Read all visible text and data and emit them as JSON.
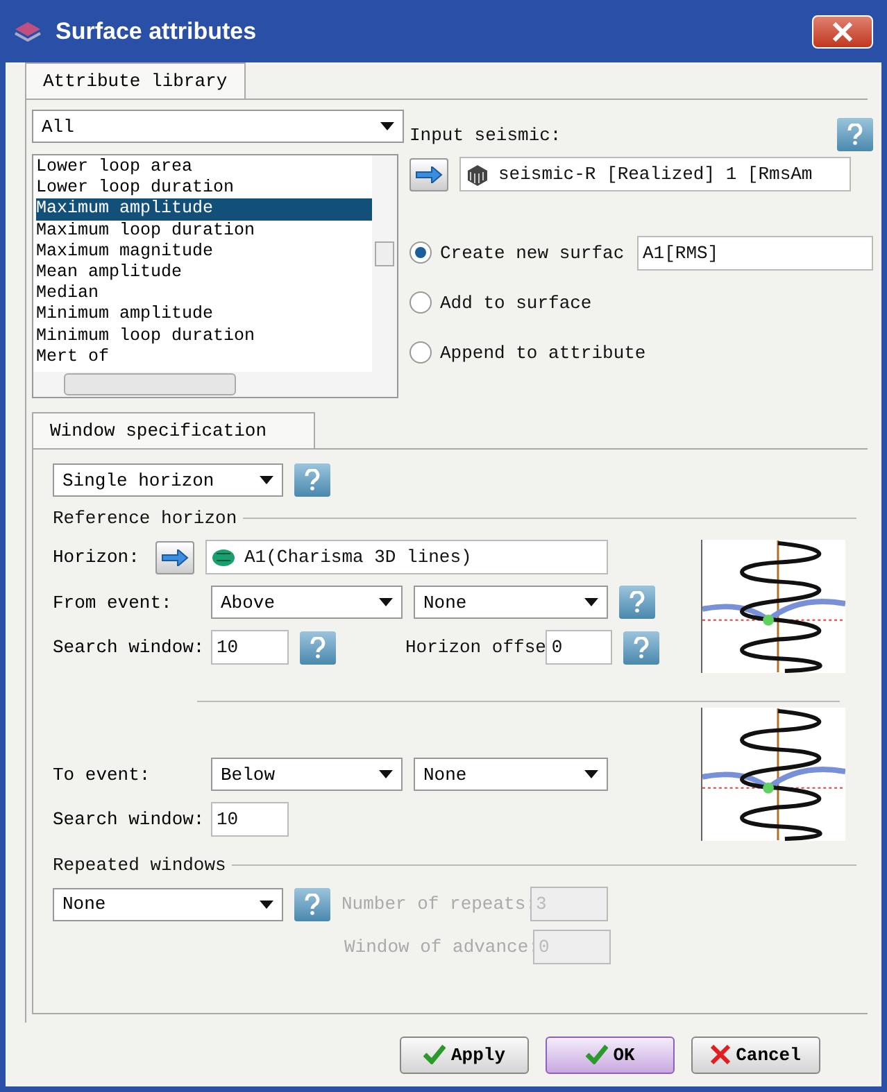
{
  "window": {
    "title": "Surface attributes"
  },
  "tabs": [
    {
      "label": "Attribute library",
      "selected": true
    }
  ],
  "category": {
    "value": "All"
  },
  "attributes": [
    {
      "label": "Lower loop area",
      "selected": false
    },
    {
      "label": "Lower loop duration",
      "selected": false
    },
    {
      "label": "Maximum amplitude",
      "selected": true
    },
    {
      "label": "Maximum loop duration",
      "selected": false
    },
    {
      "label": "Maximum magnitude",
      "selected": false
    },
    {
      "label": "Mean amplitude",
      "selected": false
    },
    {
      "label": "Median",
      "selected": false
    },
    {
      "label": "Minimum amplitude",
      "selected": false
    },
    {
      "label": "Minimum loop duration",
      "selected": false
    },
    {
      "label": "Mert of",
      "selected": false
    }
  ],
  "input_seismic": {
    "label": "Input seismic:",
    "value": "seismic-R [Realized] 1 [RmsAm"
  },
  "output_options": [
    {
      "label": "Create new surfac",
      "selected": true
    },
    {
      "label": "Add to surface",
      "selected": false
    },
    {
      "label": "Append to attribute",
      "selected": false
    }
  ],
  "new_surface_name": "A1[RMS]",
  "window_spec": {
    "tab": {
      "label": "Window specification",
      "selected": true
    },
    "mode": "Single horizon",
    "reference_header": "Reference horizon",
    "horizon": {
      "label": "Horizon:",
      "value": "A1(Charisma 3D lines)"
    },
    "from_event": {
      "label": "From event:",
      "direction": "Above",
      "polarity": "None"
    },
    "search_window": {
      "label": "Search window:",
      "value": "10"
    },
    "horizon_offset": {
      "label": "Horizon offse",
      "value": "0"
    },
    "to_event": {
      "label": "To event:",
      "direction": "Below",
      "polarity": "None"
    },
    "search_window_2": {
      "label": "Search window:",
      "value": "10"
    },
    "repeated": {
      "header": "Repeated windows",
      "mode": "None",
      "repeats": {
        "label": "Number of repeats:",
        "value": "3",
        "disabled": true
      },
      "advance": {
        "label": "Window of advance:",
        "value": "0",
        "disabled": true
      }
    }
  },
  "buttons": [
    {
      "label": "Apply",
      "kind": "apply",
      "focused": false
    },
    {
      "label": "OK",
      "kind": "ok",
      "focused": true
    },
    {
      "label": "Cancel",
      "kind": "cancel",
      "focused": false
    }
  ]
}
